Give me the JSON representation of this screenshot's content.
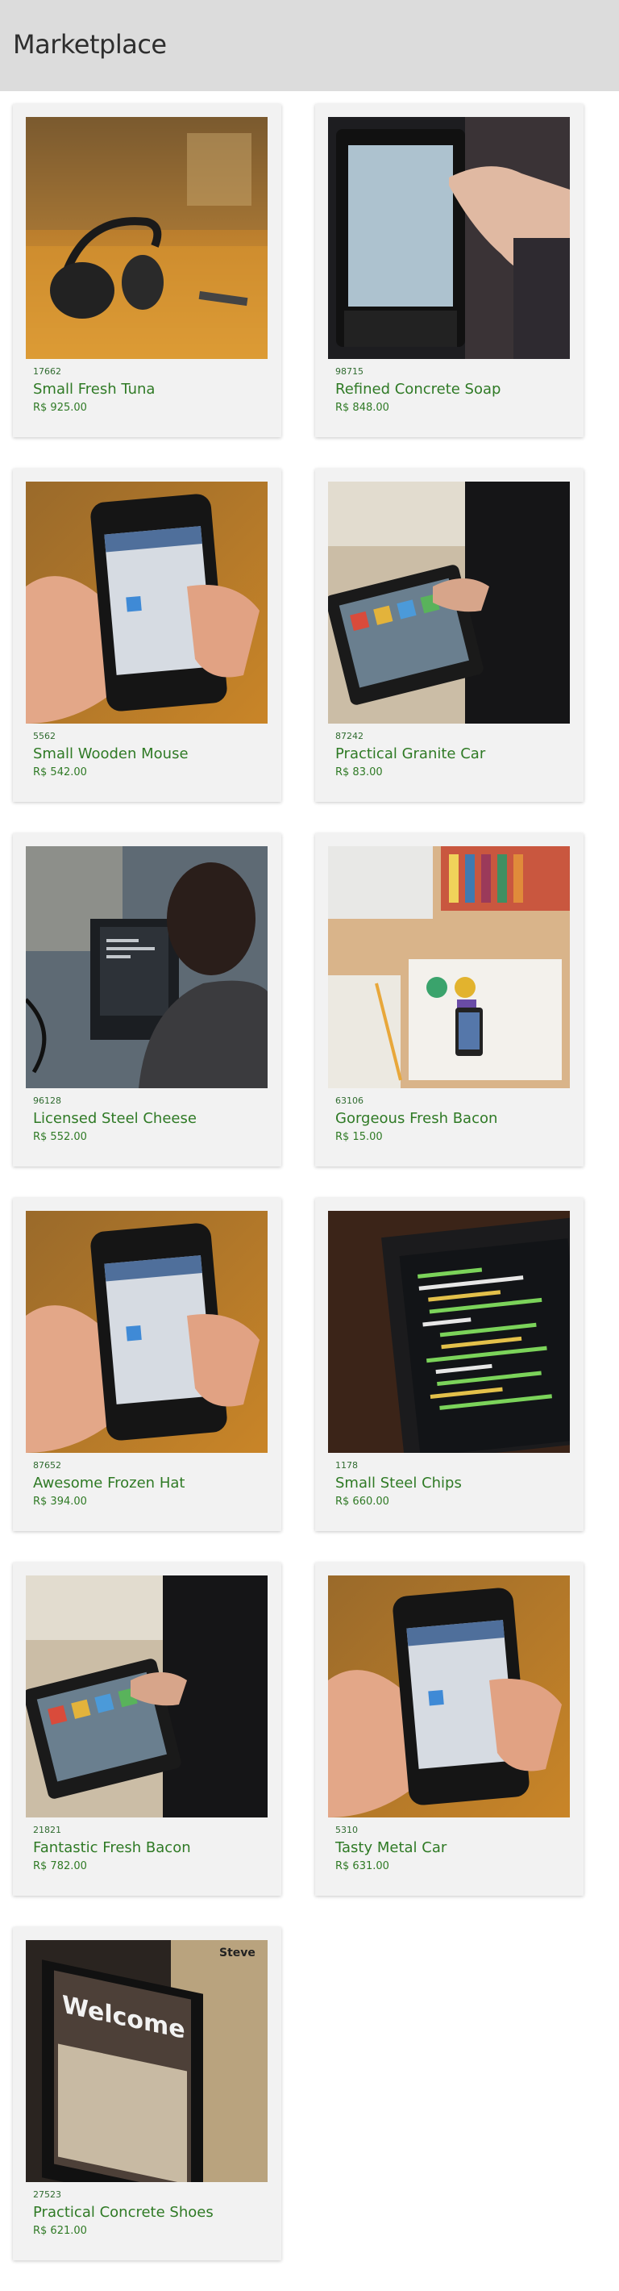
{
  "header": {
    "title": "Marketplace"
  },
  "products": [
    {
      "id": "17662",
      "name": "Small Fresh Tuna",
      "price": "R$ 925.00",
      "image_icon": "headphones-photo-icon"
    },
    {
      "id": "98715",
      "name": "Refined Concrete Soap",
      "price": "R$ 848.00",
      "image_icon": "tablet-touch-photo-icon"
    },
    {
      "id": "5562",
      "name": "Small Wooden Mouse",
      "price": "R$ 542.00",
      "image_icon": "phone-calendar-photo-icon"
    },
    {
      "id": "87242",
      "name": "Practical Granite Car",
      "price": "R$ 83.00",
      "image_icon": "tablet-apps-photo-icon"
    },
    {
      "id": "96128",
      "name": "Licensed Steel Cheese",
      "price": "R$ 552.00",
      "image_icon": "laptop-coder-photo-icon"
    },
    {
      "id": "63106",
      "name": "Gorgeous Fresh Bacon",
      "price": "R$ 15.00",
      "image_icon": "desk-flatlay-photo-icon"
    },
    {
      "id": "87652",
      "name": "Awesome Frozen Hat",
      "price": "R$ 394.00",
      "image_icon": "phone-calendar-photo-icon"
    },
    {
      "id": "1178",
      "name": "Small Steel Chips",
      "price": "R$ 660.00",
      "image_icon": "monitor-code-photo-icon"
    },
    {
      "id": "21821",
      "name": "Fantastic Fresh Bacon",
      "price": "R$ 782.00",
      "image_icon": "tablet-apps-photo-icon"
    },
    {
      "id": "5310",
      "name": "Tasty Metal Car",
      "price": "R$ 631.00",
      "image_icon": "phone-calendar-photo-icon"
    },
    {
      "id": "27523",
      "name": "Practical Concrete Shoes",
      "price": "R$ 621.00",
      "image_icon": "tablet-welcome-photo-icon"
    }
  ],
  "welcome_screen_text": "Welcome",
  "welcome_screen_author": "Steve",
  "colors": {
    "header_bg": "#dcdcdc",
    "card_bg": "#f2f2f2",
    "accent_green": "#2f7a25"
  }
}
